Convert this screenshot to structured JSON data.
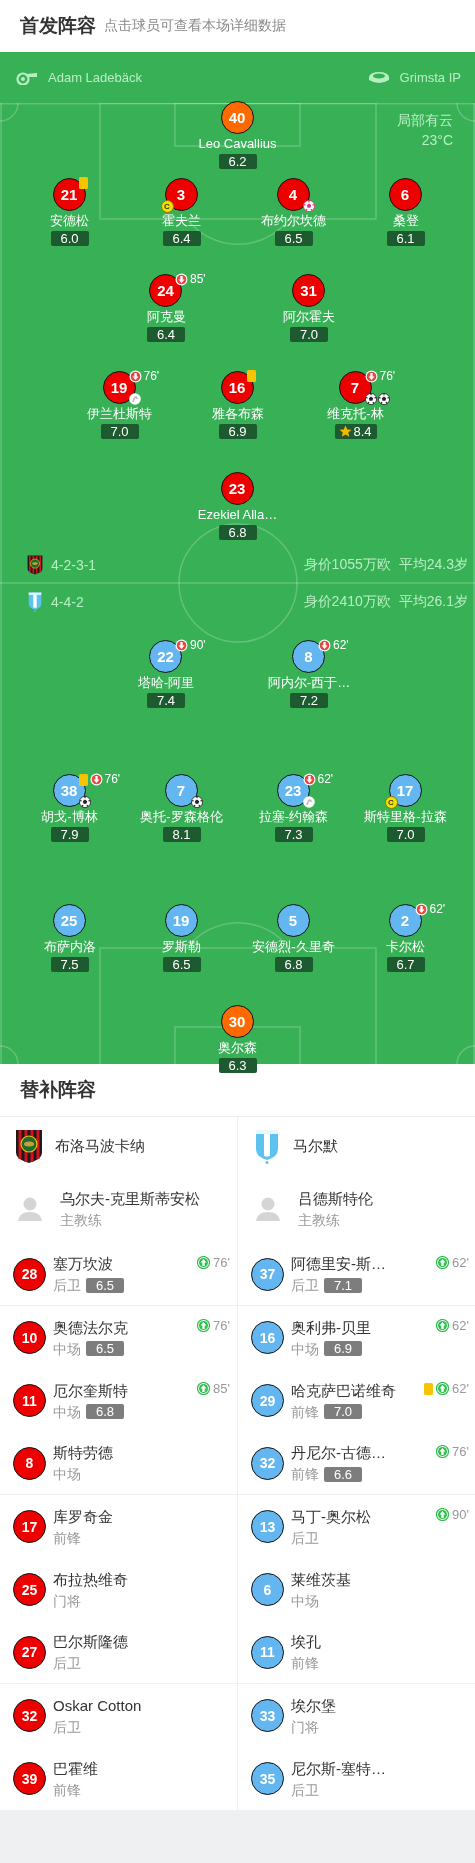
{
  "lineup_header": {
    "title": "首发阵容",
    "hint": "点击球员可查看本场详细数据"
  },
  "match_info": {
    "referee": "Adam Ladebäck",
    "stadium": "Grimsta IP",
    "weather": "局部有云",
    "temperature": "23°C"
  },
  "teams": [
    {
      "color": "#ee0000",
      "formation": "4-2-3-1",
      "value": "身价1055万欧",
      "average_age": "平均24.3岁",
      "lines": [
        [
          {
            "number": "40",
            "name": "Leo Cavallius",
            "rating": "6.2",
            "kind": "keeper",
            "yellow_card": false,
            "best": false
          }
        ],
        [
          {
            "number": "21",
            "name": "安德松",
            "rating": "6.0",
            "kind": "outfield",
            "yellow_card": true,
            "best": false
          },
          {
            "number": "3",
            "name": "霍夫兰",
            "rating": "6.4",
            "kind": "outfield",
            "yellow_card": false,
            "best": false,
            "captain_badge": "C"
          },
          {
            "number": "4",
            "name": "布约尔坎德",
            "rating": "6.5",
            "kind": "outfield",
            "yellow_card": false,
            "best": false,
            "events": [
              {
                "kind": "own_goal"
              }
            ]
          },
          {
            "number": "6",
            "name": "桑登",
            "rating": "6.1",
            "kind": "outfield",
            "yellow_card": false,
            "best": false
          }
        ],
        [
          {
            "number": "24",
            "name": "阿克曼",
            "rating": "6.4",
            "kind": "outfield",
            "yellow_card": false,
            "best": false,
            "sub_out": "85'"
          },
          {
            "number": "31",
            "name": "阿尔霍夫",
            "rating": "7.0",
            "kind": "outfield",
            "yellow_card": false,
            "best": false
          }
        ],
        [
          {
            "number": "19",
            "name": "伊兰杜斯特",
            "rating": "7.0",
            "kind": "outfield",
            "yellow_card": false,
            "best": false,
            "sub_out": "76'",
            "events": [
              {
                "kind": "assist"
              }
            ]
          },
          {
            "number": "16",
            "name": "雅各布森",
            "rating": "6.9",
            "kind": "outfield",
            "yellow_card": true,
            "best": false
          },
          {
            "number": "7",
            "name": "维克托-林",
            "rating": "8.4",
            "kind": "outfield",
            "yellow_card": false,
            "best": true,
            "sub_out": "76'",
            "events": [
              {
                "kind": "goal"
              },
              {
                "kind": "goal"
              }
            ]
          }
        ],
        [
          {
            "number": "23",
            "name": "Ezekiel Alla…",
            "rating": "6.8",
            "kind": "outfield",
            "yellow_card": false,
            "best": false
          }
        ]
      ]
    },
    {
      "color": "#63b6ef",
      "formation": "4-4-2",
      "value": "身价2410万欧",
      "average_age": "平均26.1岁",
      "lines": [
        [
          {
            "number": "22",
            "name": "塔哈-阿里",
            "rating": "7.4",
            "kind": "outfield",
            "yellow_card": false,
            "best": false,
            "sub_out": "90'"
          },
          {
            "number": "8",
            "name": "阿内尔-西于…",
            "rating": "7.2",
            "kind": "outfield",
            "yellow_card": false,
            "best": false,
            "sub_out": "62'"
          }
        ],
        [
          {
            "number": "38",
            "name": "胡戈-博林",
            "rating": "7.9",
            "kind": "outfield",
            "yellow_card": true,
            "best": false,
            "sub_out": "76'",
            "events": [
              {
                "kind": "goal"
              }
            ]
          },
          {
            "number": "7",
            "name": "奥托-罗森格伦",
            "rating": "8.1",
            "kind": "outfield",
            "yellow_card": false,
            "best": false,
            "events": [
              {
                "kind": "goal"
              }
            ]
          },
          {
            "number": "23",
            "name": "拉塞-约翰森",
            "rating": "7.3",
            "kind": "outfield",
            "yellow_card": false,
            "best": false,
            "sub_out": "62'",
            "events": [
              {
                "kind": "assist"
              }
            ]
          },
          {
            "number": "17",
            "name": "斯特里格-拉森",
            "rating": "7.0",
            "kind": "outfield",
            "yellow_card": false,
            "best": false,
            "captain_badge": "C"
          }
        ],
        [
          {
            "number": "25",
            "name": "布萨内洛",
            "rating": "7.5",
            "kind": "outfield",
            "yellow_card": false,
            "best": false
          },
          {
            "number": "19",
            "name": "罗斯勒",
            "rating": "6.5",
            "kind": "outfield",
            "yellow_card": false,
            "best": false
          },
          {
            "number": "5",
            "name": "安德烈-久里奇",
            "rating": "6.8",
            "kind": "outfield",
            "yellow_card": false,
            "best": false
          },
          {
            "number": "2",
            "name": "卡尔松",
            "rating": "6.7",
            "kind": "outfield",
            "yellow_card": false,
            "best": false,
            "sub_out": "62'"
          }
        ],
        [
          {
            "number": "30",
            "name": "奥尔森",
            "rating": "6.3",
            "kind": "keeper",
            "yellow_card": false,
            "best": false
          }
        ]
      ]
    }
  ],
  "subs": {
    "title": "替补阵容",
    "columns": [
      {
        "team": "布洛马波卡纳",
        "coach": "乌尔夫-克里斯蒂安松",
        "coach_role": "主教练",
        "players": [
          {
            "number": "28",
            "name": "塞万坎波",
            "position": "后卫",
            "rating": "6.5",
            "sub_in": "76'",
            "yellow_card": false
          },
          {
            "number": "10",
            "name": "奥德法尔克",
            "position": "中场",
            "rating": "6.5",
            "sub_in": "76'",
            "yellow_card": false
          },
          {
            "number": "11",
            "name": "厄尔奎斯特",
            "position": "中场",
            "rating": "6.8",
            "sub_in": "85'",
            "yellow_card": false
          },
          {
            "number": "8",
            "name": "斯特劳德",
            "position": "中场",
            "yellow_card": false
          },
          {
            "number": "17",
            "name": "库罗奇金",
            "position": "前锋",
            "yellow_card": false
          },
          {
            "number": "25",
            "name": "布拉热维奇",
            "position": "门将",
            "yellow_card": false
          },
          {
            "number": "27",
            "name": "巴尔斯隆德",
            "position": "后卫",
            "yellow_card": false
          },
          {
            "number": "32",
            "name": "Oskar Cotton",
            "position": "后卫",
            "yellow_card": false
          },
          {
            "number": "39",
            "name": "巴霍维",
            "position": "前锋",
            "yellow_card": false
          }
        ]
      },
      {
        "team": "马尔默",
        "coach": "吕德斯特伦",
        "coach_role": "主教练",
        "players": [
          {
            "number": "37",
            "name": "阿德里安-斯…",
            "position": "后卫",
            "rating": "7.1",
            "sub_in": "62'",
            "yellow_card": false
          },
          {
            "number": "16",
            "name": "奥利弗-贝里",
            "position": "中场",
            "rating": "6.9",
            "sub_in": "62'",
            "yellow_card": false
          },
          {
            "number": "29",
            "name": "哈克萨巴诺维奇",
            "position": "前锋",
            "rating": "7.0",
            "sub_in": "62'",
            "yellow_card": true
          },
          {
            "number": "32",
            "name": "丹尼尔-古德…",
            "position": "前锋",
            "rating": "6.6",
            "sub_in": "76'",
            "yellow_card": false
          },
          {
            "number": "13",
            "name": "马丁-奥尔松",
            "position": "后卫",
            "sub_in": "90'",
            "yellow_card": false
          },
          {
            "number": "6",
            "name": "莱维茨基",
            "position": "中场",
            "yellow_card": false
          },
          {
            "number": "11",
            "name": "埃孔",
            "position": "前锋",
            "yellow_card": false
          },
          {
            "number": "33",
            "name": "埃尔堡",
            "position": "门将",
            "yellow_card": false
          },
          {
            "number": "35",
            "name": "尼尔斯-塞特…",
            "position": "后卫",
            "yellow_card": false
          }
        ]
      }
    ]
  }
}
